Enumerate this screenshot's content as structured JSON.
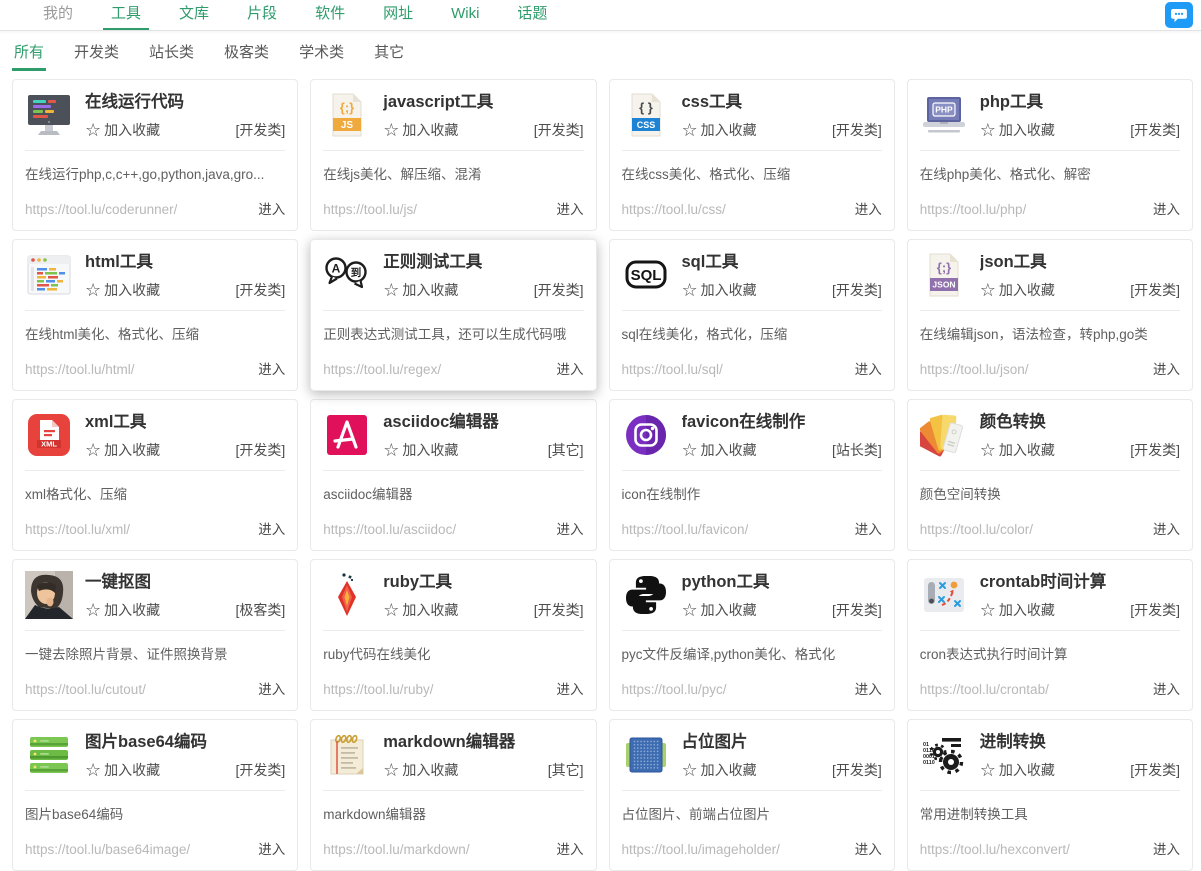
{
  "colors": {
    "accent_green": "#2e9c6b",
    "chat_blue": "#1d9bf7"
  },
  "nav": {
    "items": [
      {
        "key": "my",
        "label": "我的",
        "style": "muted"
      },
      {
        "key": "tools",
        "label": "工具",
        "style": "active"
      },
      {
        "key": "docs",
        "label": "文库",
        "style": ""
      },
      {
        "key": "snippets",
        "label": "片段",
        "style": ""
      },
      {
        "key": "software",
        "label": "软件",
        "style": ""
      },
      {
        "key": "urls",
        "label": "网址",
        "style": ""
      },
      {
        "key": "wiki",
        "label": "Wiki",
        "style": ""
      },
      {
        "key": "topics",
        "label": "话题",
        "style": ""
      }
    ],
    "chat_icon": "chat-bubble-icon"
  },
  "filters": {
    "items": [
      {
        "key": "all",
        "label": "所有",
        "active": true
      },
      {
        "key": "dev",
        "label": "开发类",
        "active": false
      },
      {
        "key": "webmaster",
        "label": "站长类",
        "active": false
      },
      {
        "key": "geek",
        "label": "极客类",
        "active": false
      },
      {
        "key": "academic",
        "label": "学术类",
        "active": false
      },
      {
        "key": "other",
        "label": "其它",
        "active": false
      }
    ]
  },
  "card_labels": {
    "favorite": "加入收藏",
    "enter": "进入",
    "star_icon": "☆"
  },
  "cards": [
    {
      "title": "在线运行代码",
      "icon": "code-runner",
      "category": "[开发类]",
      "description": "在线运行php,c,c++,go,python,java,gro...",
      "url": "https://tool.lu/coderunner/",
      "hovered": false
    },
    {
      "title": "javascript工具",
      "icon": "js-file",
      "category": "[开发类]",
      "description": "在线js美化、解压缩、混淆",
      "url": "https://tool.lu/js/",
      "hovered": false
    },
    {
      "title": "css工具",
      "icon": "css-file",
      "category": "[开发类]",
      "description": "在线css美化、格式化、压缩",
      "url": "https://tool.lu/css/",
      "hovered": false
    },
    {
      "title": "php工具",
      "icon": "php-laptop",
      "category": "[开发类]",
      "description": "在线php美化、格式化、解密",
      "url": "https://tool.lu/php/",
      "hovered": false
    },
    {
      "title": "html工具",
      "icon": "html-window",
      "category": "[开发类]",
      "description": "在线html美化、格式化、压缩",
      "url": "https://tool.lu/html/",
      "hovered": false
    },
    {
      "title": "正则测试工具",
      "icon": "regex-translate",
      "category": "[开发类]",
      "description": "正则表达式测试工具，还可以生成代码哦",
      "url": "https://tool.lu/regex/",
      "hovered": true
    },
    {
      "title": "sql工具",
      "icon": "sql-badge",
      "category": "[开发类]",
      "description": "sql在线美化，格式化，压缩",
      "url": "https://tool.lu/sql/",
      "hovered": false
    },
    {
      "title": "json工具",
      "icon": "json-file",
      "category": "[开发类]",
      "description": "在线编辑json，语法检查，转php,go类",
      "url": "https://tool.lu/json/",
      "hovered": false
    },
    {
      "title": "xml工具",
      "icon": "xml-doc",
      "category": "[开发类]",
      "description": "xml格式化、压缩",
      "url": "https://tool.lu/xml/",
      "hovered": false
    },
    {
      "title": "asciidoc编辑器",
      "icon": "asciidoc",
      "category": "[其它]",
      "description": "asciidoc编辑器",
      "url": "https://tool.lu/asciidoc/",
      "hovered": false
    },
    {
      "title": "favicon在线制作",
      "icon": "favicon-camera",
      "category": "[站长类]",
      "description": "icon在线制作",
      "url": "https://tool.lu/favicon/",
      "hovered": false
    },
    {
      "title": "颜色转换",
      "icon": "color-swatches",
      "category": "[开发类]",
      "description": "颜色空间转换",
      "url": "https://tool.lu/color/",
      "hovered": false
    },
    {
      "title": "一键抠图",
      "icon": "cutout-photo",
      "category": "[极客类]",
      "description": "一键去除照片背景、证件照换背景",
      "url": "https://tool.lu/cutout/",
      "hovered": false
    },
    {
      "title": "ruby工具",
      "icon": "ruby-gem",
      "category": "[开发类]",
      "description": "ruby代码在线美化",
      "url": "https://tool.lu/ruby/",
      "hovered": false
    },
    {
      "title": "python工具",
      "icon": "python-logo",
      "category": "[开发类]",
      "description": "pyc文件反编译,python美化、格式化",
      "url": "https://tool.lu/pyc/",
      "hovered": false
    },
    {
      "title": "crontab时间计算",
      "icon": "crontab-plan",
      "category": "[开发类]",
      "description": "cron表达式执行时间计算",
      "url": "https://tool.lu/crontab/",
      "hovered": false
    },
    {
      "title": "图片base64编码",
      "icon": "base64-server",
      "category": "[开发类]",
      "description": "图片base64编码",
      "url": "https://tool.lu/base64image/",
      "hovered": false
    },
    {
      "title": "markdown编辑器",
      "icon": "markdown-notepad",
      "category": "[其它]",
      "description": "markdown编辑器",
      "url": "https://tool.lu/markdown/",
      "hovered": false
    },
    {
      "title": "占位图片",
      "icon": "imageholder-board",
      "category": "[开发类]",
      "description": "占位图片、前端占位图片",
      "url": "https://tool.lu/imageholder/",
      "hovered": false
    },
    {
      "title": "进制转换",
      "icon": "hexconvert-gears",
      "category": "[开发类]",
      "description": "常用进制转换工具",
      "url": "https://tool.lu/hexconvert/",
      "hovered": false
    }
  ]
}
